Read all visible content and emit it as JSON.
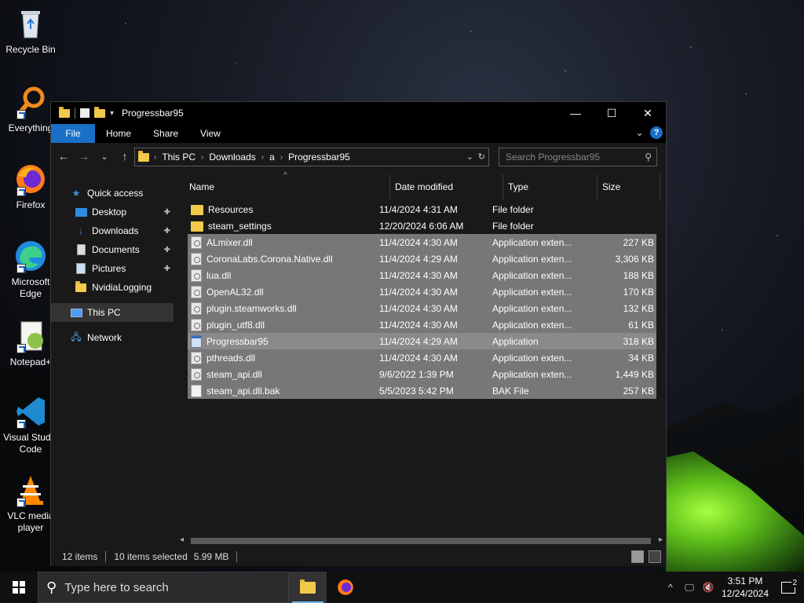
{
  "desktop": {
    "icons": [
      {
        "label": "Recycle Bin",
        "icon": "recycle-bin-icon"
      },
      {
        "label": "Everything",
        "icon": "everything-search-icon"
      },
      {
        "label": "Firefox",
        "icon": "firefox-icon"
      },
      {
        "label": "Microsoft Edge",
        "icon": "edge-icon"
      },
      {
        "label": "Notepad+",
        "icon": "notepad-plus-icon"
      },
      {
        "label": "Visual Studio Code",
        "icon": "vscode-icon"
      },
      {
        "label": "VLC media player",
        "icon": "vlc-icon"
      }
    ]
  },
  "window": {
    "title": "Progressbar95",
    "controls": {
      "minimize": "—",
      "maximize": "☐",
      "close": "✕"
    },
    "ribbon": {
      "tabs": [
        "File",
        "Home",
        "Share",
        "View"
      ],
      "expand": "⌄",
      "help": "?"
    },
    "nav": {
      "back": "←",
      "forward": "→",
      "recent": "⌄",
      "up": "↑"
    },
    "address": {
      "crumbs": [
        "This PC",
        "Downloads",
        "a",
        "Progressbar95"
      ],
      "dropdown": "⌄",
      "refresh": "↻"
    },
    "search": {
      "placeholder": "Search Progressbar95"
    },
    "sidebar": {
      "items": [
        {
          "label": "Quick access",
          "icon": "star-icon",
          "pinned": false
        },
        {
          "label": "Desktop",
          "icon": "desktop-icon",
          "pinned": true
        },
        {
          "label": "Downloads",
          "icon": "download-icon",
          "pinned": true
        },
        {
          "label": "Documents",
          "icon": "documents-icon",
          "pinned": true
        },
        {
          "label": "Pictures",
          "icon": "pictures-icon",
          "pinned": true
        },
        {
          "label": "NvidiaLogging",
          "icon": "folder-icon",
          "pinned": false
        },
        {
          "label": "This PC",
          "icon": "computer-icon",
          "pinned": false
        },
        {
          "label": "Network",
          "icon": "network-icon",
          "pinned": false
        }
      ],
      "pin_glyph": "📌"
    },
    "columns": [
      "Name",
      "Date modified",
      "Type",
      "Size"
    ],
    "sort_indicator": "^",
    "files": [
      {
        "name": "Resources",
        "date": "11/4/2024 4:31 AM",
        "type": "File folder",
        "size": "",
        "kind": "folder",
        "selected": false
      },
      {
        "name": "steam_settings",
        "date": "12/20/2024 6:06 AM",
        "type": "File folder",
        "size": "",
        "kind": "folder",
        "selected": false
      },
      {
        "name": "ALmixer.dll",
        "date": "11/4/2024 4:30 AM",
        "type": "Application exten...",
        "size": "227 KB",
        "kind": "dll",
        "selected": true
      },
      {
        "name": "CoronaLabs.Corona.Native.dll",
        "date": "11/4/2024 4:29 AM",
        "type": "Application exten...",
        "size": "3,306 KB",
        "kind": "dll",
        "selected": true
      },
      {
        "name": "lua.dll",
        "date": "11/4/2024 4:30 AM",
        "type": "Application exten...",
        "size": "188 KB",
        "kind": "dll",
        "selected": true
      },
      {
        "name": "OpenAL32.dll",
        "date": "11/4/2024 4:30 AM",
        "type": "Application exten...",
        "size": "170 KB",
        "kind": "dll",
        "selected": true
      },
      {
        "name": "plugin.steamworks.dll",
        "date": "11/4/2024 4:30 AM",
        "type": "Application exten...",
        "size": "132 KB",
        "kind": "dll",
        "selected": true
      },
      {
        "name": "plugin_utf8.dll",
        "date": "11/4/2024 4:30 AM",
        "type": "Application exten...",
        "size": "61 KB",
        "kind": "dll",
        "selected": true
      },
      {
        "name": "Progressbar95",
        "date": "11/4/2024 4:29 AM",
        "type": "Application",
        "size": "318 KB",
        "kind": "app",
        "selected": true
      },
      {
        "name": "pthreads.dll",
        "date": "11/4/2024 4:30 AM",
        "type": "Application exten...",
        "size": "34 KB",
        "kind": "dll",
        "selected": true
      },
      {
        "name": "steam_api.dll",
        "date": "9/6/2022 1:39 PM",
        "type": "Application exten...",
        "size": "1,449 KB",
        "kind": "dll",
        "selected": true
      },
      {
        "name": "steam_api.dll.bak",
        "date": "5/5/2023 5:42 PM",
        "type": "BAK File",
        "size": "257 KB",
        "kind": "bak",
        "selected": true
      }
    ],
    "status": {
      "item_count": "12 items",
      "selection": "10 items selected",
      "selection_size": "5.99 MB"
    }
  },
  "taskbar": {
    "search_placeholder": "Type here to search",
    "time": "3:51 PM",
    "date": "12/24/2024",
    "notifications": "2",
    "tray_chevron": "^"
  },
  "colors": {
    "accent": "#1a6fc7",
    "window_bg": "#191919",
    "selection": "#777777",
    "folder": "#f1c94b"
  }
}
